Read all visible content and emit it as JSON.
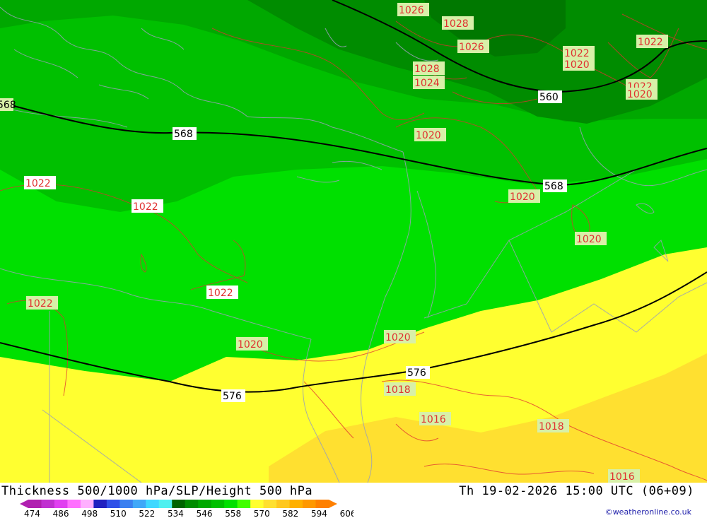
{
  "footer": {
    "title": "Thickness 500/1000 hPa/SLP/Height 500 hPa",
    "datetime": "Th 19-02-2026 15:00 UTC (06+09)",
    "credit": "©weatheronline.co.uk"
  },
  "colorbar": {
    "ticks": [
      "474",
      "486",
      "498",
      "510",
      "522",
      "534",
      "546",
      "558",
      "570",
      "582",
      "594",
      "606"
    ],
    "colors": [
      "#b020b0",
      "#c030d0",
      "#e040f0",
      "#ff70ff",
      "#ffb0ff",
      "#2020c0",
      "#3050e8",
      "#3a80f0",
      "#40a8f8",
      "#40d8ff",
      "#50f0f0",
      "#006400",
      "#008c00",
      "#00a800",
      "#00c000",
      "#00e000",
      "#40ff00",
      "#ffff30",
      "#ffe030",
      "#ffc820",
      "#ffb000",
      "#ff9800",
      "#ff8000"
    ]
  },
  "height_labels": [
    {
      "text": "568"
    },
    {
      "text": "568"
    },
    {
      "text": "568"
    },
    {
      "text": "560"
    },
    {
      "text": "576"
    },
    {
      "text": "576"
    }
  ],
  "pressure_labels": [
    {
      "text": "1026"
    },
    {
      "text": "1028"
    },
    {
      "text": "1026"
    },
    {
      "text": "1028"
    },
    {
      "text": "1024"
    },
    {
      "text": "1022"
    },
    {
      "text": "1022"
    },
    {
      "text": "1020"
    },
    {
      "text": "1022"
    },
    {
      "text": "1020"
    },
    {
      "text": "1020"
    },
    {
      "text": "1020"
    },
    {
      "text": "1022"
    },
    {
      "text": "1022"
    },
    {
      "text": "1022"
    },
    {
      "text": "1022"
    },
    {
      "text": "1020"
    },
    {
      "text": "1020"
    },
    {
      "text": "1018"
    },
    {
      "text": "1016"
    },
    {
      "text": "1018"
    },
    {
      "text": "1016"
    },
    {
      "text": "1022"
    },
    {
      "text": "1020"
    }
  ]
}
